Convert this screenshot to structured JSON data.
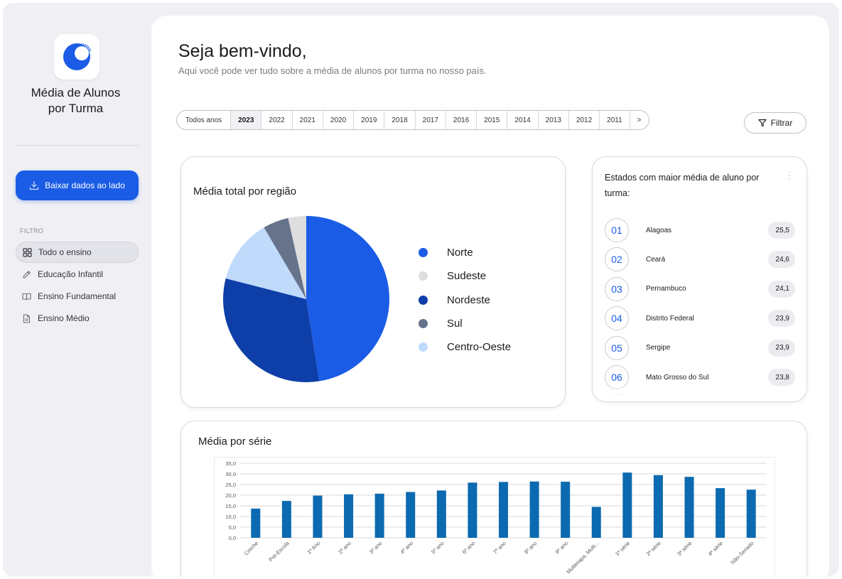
{
  "sidebar": {
    "app_title_line1": "Média de Alunos",
    "app_title_line2": "por Turma",
    "logo_icon": "sunburst-logo-icon",
    "download_label": "Baixar dados ao lado",
    "filter_caption": "FILTRO",
    "nav": [
      {
        "label": "Todo o ensino",
        "icon": "grid-icon",
        "active": true
      },
      {
        "label": "Educação Infantil",
        "icon": "pencil-icon",
        "active": false
      },
      {
        "label": "Ensino Fundamental",
        "icon": "book-icon",
        "active": false
      },
      {
        "label": "Ensino Médio",
        "icon": "document-icon",
        "active": false
      }
    ]
  },
  "header": {
    "greeting": "Seja bem-vindo,",
    "subtitle": "Aqui você pode ver tudo sobre a média de alunos por turma no nosso país."
  },
  "years": {
    "items": [
      "Todos anos",
      "2023",
      "2022",
      "2021",
      "2020",
      "2019",
      "2018",
      "2017",
      "2016",
      "2015",
      "2014",
      "2013",
      "2012",
      "2011",
      ">"
    ],
    "selected": "2023"
  },
  "filter_label": "Filtrar",
  "region_card": {
    "title": "Média total por região"
  },
  "states_card": {
    "title": "Estados com maior média de aluno por turma:",
    "rows": [
      {
        "rank": "01",
        "name": "Alagoas",
        "value": "25,5"
      },
      {
        "rank": "02",
        "name": "Ceará",
        "value": "24,6"
      },
      {
        "rank": "03",
        "name": "Pernambuco",
        "value": "24,1"
      },
      {
        "rank": "04",
        "name": "Distrito Federal",
        "value": "23,9"
      },
      {
        "rank": "05",
        "name": "Sergipe",
        "value": "23,9"
      },
      {
        "rank": "06",
        "name": "Mato Grosso do Sul",
        "value": "23,8"
      }
    ]
  },
  "series_card": {
    "title": "Média por série"
  },
  "chart_data": [
    {
      "type": "pie",
      "title": "Média total por região",
      "categories": [
        "Norte",
        "Nordeste",
        "Centro-Oeste",
        "Sul",
        "Sudeste"
      ],
      "values": [
        47.5,
        31.5,
        12.5,
        5.0,
        3.5
      ],
      "colors": [
        "#1a5ce6",
        "#0e3fa8",
        "#c0dafc",
        "#66738b",
        "#dededf"
      ],
      "legend_order": [
        "Norte",
        "Sudeste",
        "Nordeste",
        "Sul",
        "Centro-Oeste"
      ],
      "legend_position": "right"
    },
    {
      "type": "bar",
      "title": "Média por série",
      "categories": [
        "Creche",
        "Pré-Escola",
        "1º Ano",
        "2º ano",
        "3º ano",
        "4º ano",
        "5º ano",
        "6º ano",
        "7º ano",
        "8º ano",
        "9º ano",
        "Multietapa, Multi...",
        "1ª série",
        "2ª série",
        "3ª série",
        "4ª série",
        "Não-Seriado"
      ],
      "values": [
        13.7,
        17.3,
        19.8,
        20.4,
        20.7,
        21.5,
        22.2,
        25.9,
        26.2,
        26.4,
        26.3,
        14.5,
        30.6,
        29.4,
        28.6,
        23.3,
        22.6
      ],
      "ylim": [
        0,
        35
      ],
      "yticks": [
        "0,0",
        "5,0",
        "10,0",
        "15,0",
        "20,0",
        "25,0",
        "30,0",
        "35,0"
      ],
      "grid": true,
      "color": "#0b6ab0"
    }
  ]
}
